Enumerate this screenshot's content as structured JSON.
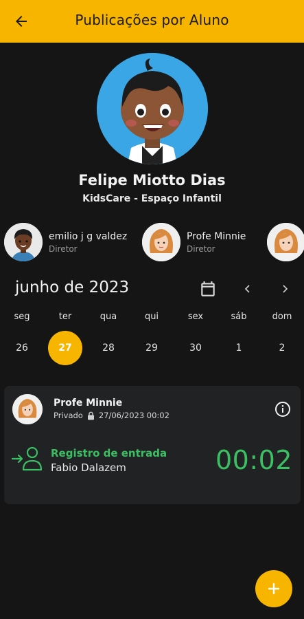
{
  "appbar": {
    "title": "Publicações por Aluno",
    "back_icon": "arrow-left-icon"
  },
  "student": {
    "name": "Felipe Miotto Dias",
    "school": "KidsCare - Espaço Infantil"
  },
  "staff": [
    {
      "name": "emilio j g valdez",
      "role": "Diretor"
    },
    {
      "name": "Profe Minnie",
      "role": "Diretor"
    },
    {
      "name": "",
      "role": ""
    }
  ],
  "calendar": {
    "month_label": "junho de 2023",
    "weekdays": [
      "seg",
      "ter",
      "qua",
      "qui",
      "sex",
      "sáb",
      "dom"
    ],
    "days": [
      "26",
      "27",
      "28",
      "29",
      "30",
      "1",
      "2"
    ],
    "selected_day": "27",
    "accent": "#f7b500"
  },
  "post": {
    "author": "Profe Minnie",
    "visibility": "Privado",
    "datetime": "27/06/2023 00:02",
    "event_title": "Registro de entrada",
    "person": "Fabio Dalazem",
    "time": "00:02",
    "event_color": "#3bbf62"
  },
  "fab": {
    "label": "+",
    "icon": "plus-icon"
  }
}
